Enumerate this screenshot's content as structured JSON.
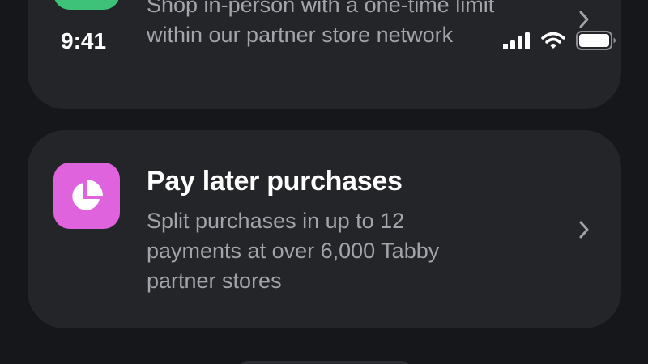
{
  "status_bar": {
    "time": "9:41",
    "signal_icon": "cellular-signal-icon",
    "wifi_icon": "wifi-icon",
    "battery_icon": "battery-icon"
  },
  "cards": [
    {
      "title": "",
      "description": "Shop in-person with a one-time limit within our partner store network",
      "icon": "store-icon",
      "icon_color": "#3ec27a",
      "chevron_icon": "chevron-right-icon"
    },
    {
      "title": "Pay later purchases",
      "description": "Split purchases in up to 12 payments at over 6,000 Tabby partner stores",
      "icon": "pie-chart-icon",
      "icon_color": "#de63dc",
      "chevron_icon": "chevron-right-icon"
    }
  ],
  "colors": {
    "background": "#16171b",
    "card": "#242529",
    "text_primary": "#ffffff",
    "text_secondary": "#a2a4ab"
  }
}
